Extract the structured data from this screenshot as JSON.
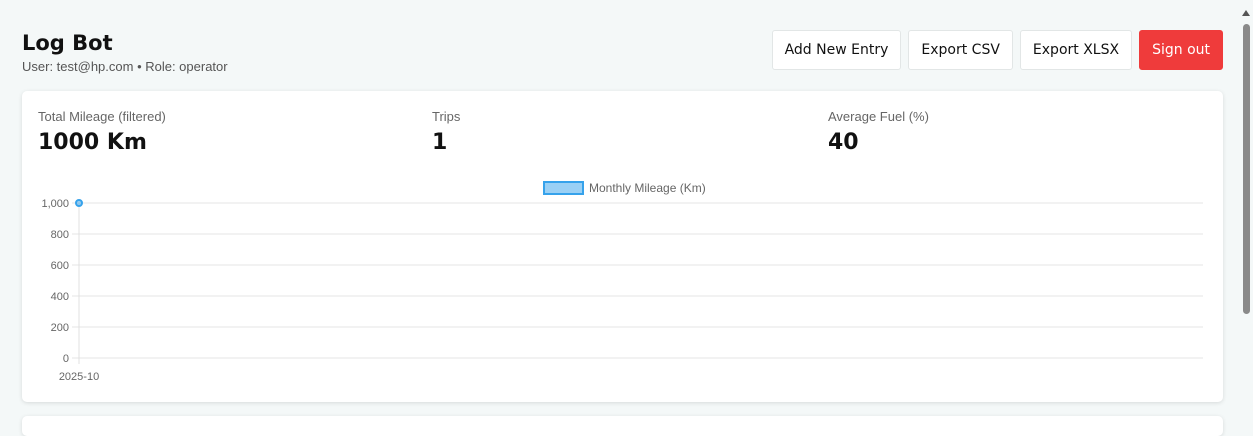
{
  "header": {
    "title": "Log Bot",
    "user_line": "User: test@hp.com • Role: operator"
  },
  "toolbar": {
    "add_label": "Add New Entry",
    "csv_label": "Export CSV",
    "xlsx_label": "Export XLSX",
    "signout_label": "Sign out",
    "signout_color": "#ef3b3b"
  },
  "stats": {
    "mileage_label": "Total Mileage (filtered)",
    "mileage_value": "1000 Km",
    "trips_label": "Trips",
    "trips_value": "1",
    "fuel_label": "Average Fuel (%)",
    "fuel_value": "40"
  },
  "chart_data": {
    "type": "line",
    "categories": [
      "2025-10"
    ],
    "series": [
      {
        "name": "Monthly Mileage (Km)",
        "values": [
          1000
        ],
        "color": "#36a2eb"
      }
    ],
    "yticks": [
      "0",
      "200",
      "400",
      "600",
      "800",
      "1,000"
    ],
    "ylim": [
      0,
      1000
    ],
    "grid": true,
    "legend_position": "top"
  }
}
